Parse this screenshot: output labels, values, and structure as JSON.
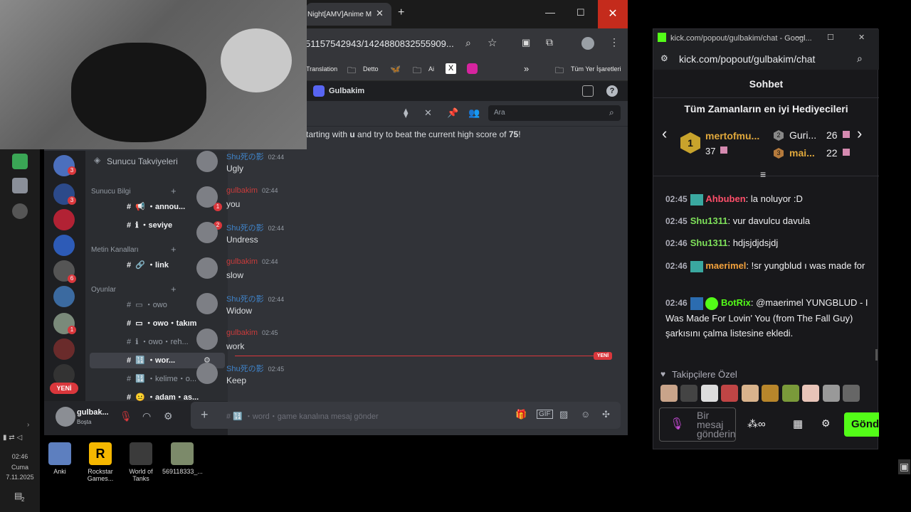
{
  "taskbar": {
    "time": "02:46",
    "day": "Cuma",
    "date": "7.11.2025",
    "notif_count": "2"
  },
  "desktop": {
    "icons": [
      {
        "label": "Anki"
      },
      {
        "label": "Rockstar Games..."
      },
      {
        "label": "World of Tanks"
      },
      {
        "label": "569118333_..."
      }
    ]
  },
  "browser": {
    "tab_title": "Night[AMV]Anime M",
    "url": "51157542943/1424880832555909...",
    "bookmarks": [
      "Translation",
      "Detto",
      "Ai",
      "Tüm Yer İşaretleri"
    ],
    "more": "»"
  },
  "discord": {
    "server_name": "Gulbakim",
    "search_placeholder": "Ara",
    "banner_pre": "tarting with ",
    "banner_letter": "u",
    "banner_mid": " and try to beat the current high score of ",
    "banner_score": "75",
    "banner_end": "!",
    "boosts": "Sunucu Takviyeleri",
    "cat_info": "Sunucu Bilgi",
    "cat_text": "Metin Kanalları",
    "cat_games": "Oyunlar",
    "channels": [
      {
        "name": "annou...",
        "badge": "1"
      },
      {
        "name": "seviye",
        "badge": "2"
      },
      {
        "name": "link"
      },
      {
        "name": "owo"
      },
      {
        "name": "owo・takım"
      },
      {
        "name": "owo・reh..."
      },
      {
        "name": "wor..."
      },
      {
        "name": "kelime・o..."
      },
      {
        "name": "adam・as..."
      }
    ],
    "guild_badges": [
      "3",
      "3",
      "6",
      "1"
    ],
    "new_pill": "YENİ",
    "new_divider": "YENİ",
    "messages": [
      {
        "author": "Shu死の影",
        "time": "02:44",
        "text": "Ugly",
        "color": "#3f83c9"
      },
      {
        "author": "gulbakim",
        "time": "02:44",
        "text": "you",
        "color": "#c83b3b"
      },
      {
        "author": "Shu死の影",
        "time": "02:44",
        "text": "Undress",
        "color": "#3f83c9"
      },
      {
        "author": "gulbakim",
        "time": "02:44",
        "text": "slow",
        "color": "#c83b3b"
      },
      {
        "author": "Shu死の影",
        "time": "02:44",
        "text": "Widow",
        "color": "#3f83c9"
      },
      {
        "author": "gulbakim",
        "time": "02:45",
        "text": "work",
        "color": "#c83b3b"
      },
      {
        "author": "Shu死の影",
        "time": "02:45",
        "text": "Keep",
        "color": "#3f83c9"
      }
    ],
    "input_placeholder": "# 🔢 ・word・game kanalına mesaj gönder",
    "user": {
      "name": "gulbak...",
      "status": "Boşta"
    }
  },
  "kick": {
    "window_title": "kick.com/popout/gulbakim/chat - Googl...",
    "url": "kick.com/popout/gulbakim/chat",
    "header": "Sohbet",
    "gifters_title": "Tüm Zamanların en iyi Hediyecileri",
    "gifters": [
      {
        "rank": "1",
        "name": "mertofmu...",
        "count": "37"
      },
      {
        "rank": "2",
        "name": "Guri...",
        "count": "26"
      },
      {
        "rank": "3",
        "name": "mai...",
        "count": "22"
      }
    ],
    "chat": [
      {
        "time": "02:45",
        "user": "Ahbuben",
        "color": "#ff4f6a",
        "text": "la noluyor :D"
      },
      {
        "time": "02:45",
        "user": "Shu1311",
        "color": "#7ee05a",
        "text": "vur davulcu davula"
      },
      {
        "time": "02:46",
        "user": "Shu1311",
        "color": "#7ee05a",
        "text": "hdjsjdjdsjdj"
      },
      {
        "time": "02:46",
        "user": "maerimel",
        "color": "#f4a23c",
        "text": "!sr yungblud ı was made for"
      },
      {
        "time": "02:46",
        "user": "BotRix",
        "color": "#53fc18",
        "text": "@maerimel YUNGBLUD - I Was Made For Lovin' You (from The Fall Guy) şarkısını çalma listesine ekledi."
      }
    ],
    "followers_only": "Takipçilere Özel",
    "message_placeholder": "Bir mesaj gönderin",
    "send": "Gönd"
  }
}
